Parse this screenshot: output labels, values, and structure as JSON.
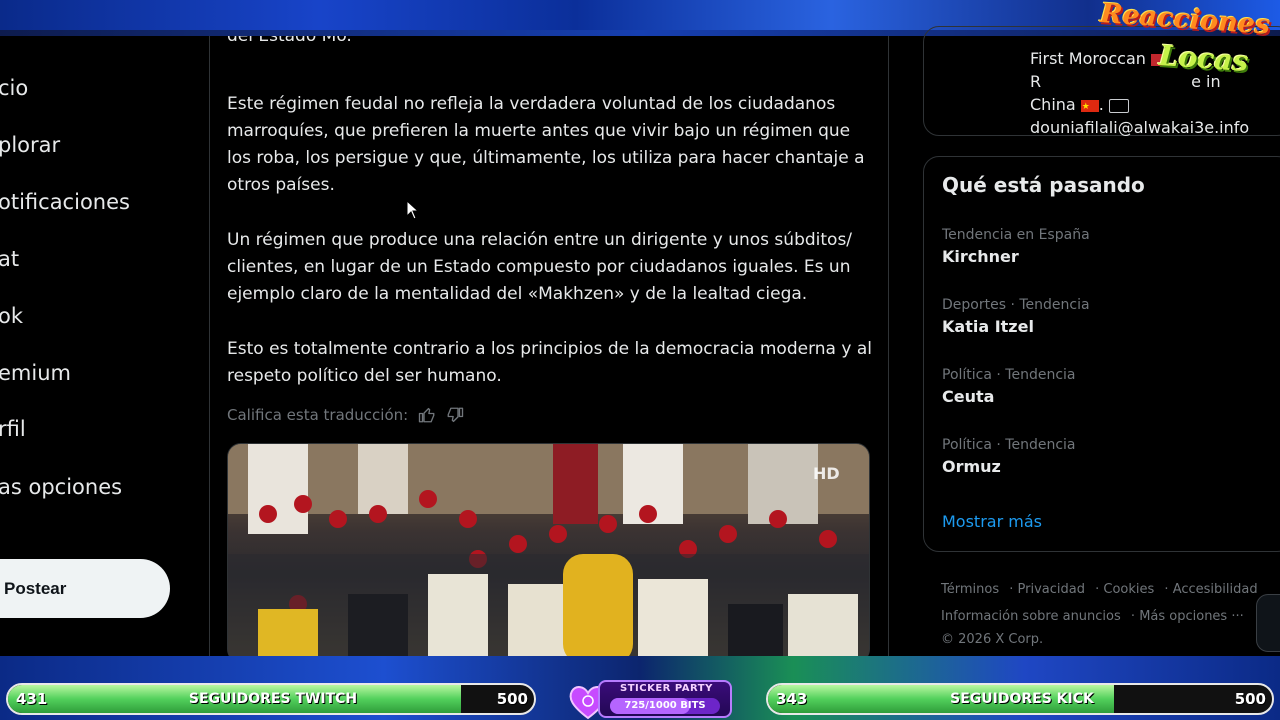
{
  "overlay": {
    "logo_line1": "Reacciones",
    "logo_line2": "Locas",
    "twitch": {
      "label": "SEGUIDORES TWITCH",
      "current": "431",
      "goal": "500",
      "progress": 0.862
    },
    "kick": {
      "label": "SEGUIDORES KICK",
      "current": "343",
      "goal": "500",
      "progress": 0.686
    },
    "sticker": {
      "title": "STICKER PARTY",
      "count": "725/1000 BITS",
      "progress": 0.725
    }
  },
  "nav": {
    "items": [
      "cio",
      "plorar",
      "otificaciones",
      "at",
      "ok",
      "emium",
      "rfil",
      "as opciones"
    ],
    "post_label": "Postear"
  },
  "post": {
    "top_partial": "del Estado Mo.",
    "paragraphs": [
      "Este régimen feudal no refleja la verdadera voluntad de los ciudadanos marroquíes, que prefieren la muerte antes que vivir bajo un régimen que los roba, los persigue y que, últimamente, los utiliza para hacer chantaje a otros países.",
      "Un régimen que produce una relación entre un dirigente y unos súbditos/ clientes, en lugar de un Estado compuesto por ciudadanos iguales. Es un ejemplo claro de la mentalidad del «Makhzen» y de la lealtad ciega.",
      "Esto es totalmente contrario a los principios de la democracia moderna y al respeto político del ser humano."
    ],
    "rate_label": "Califica esta traducción:"
  },
  "profile": {
    "line1_start": "First Moroccan",
    "line1_end": "R",
    "line1_tail": "e in",
    "line2": "China",
    "line2_suffix": ".",
    "email": "douniafilali@alwakai3e.info"
  },
  "trends": {
    "title": "Qué está pasando",
    "items": [
      {
        "context": "Tendencia en España",
        "name": "Kirchner"
      },
      {
        "context": "Deportes · Tendencia",
        "name": "Katia Itzel"
      },
      {
        "context": "Política · Tendencia",
        "name": "Ceuta"
      },
      {
        "context": "Política · Tendencia",
        "name": "Ormuz"
      }
    ],
    "show_more": "Mostrar más"
  },
  "footer": {
    "links": [
      "Términos",
      "Privacidad",
      "Cookies",
      "Accesibilidad",
      "Información sobre anuncios",
      "Más opciones ···"
    ],
    "copyright": "© 2026 X Corp."
  },
  "colors": {
    "link_blue": "#1d9bf0",
    "muted": "#71767b",
    "text": "#e7e9ea",
    "border": "#2f3336"
  }
}
